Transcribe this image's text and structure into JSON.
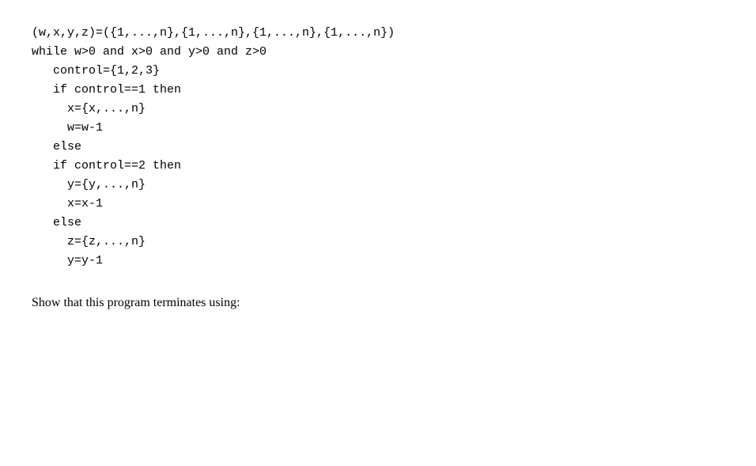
{
  "code": {
    "lines": [
      "(w,x,y,z)=({1,...,n},{1,...,n},{1,...,n},{1,...,n})",
      "while w>0 and x>0 and y>0 and z>0",
      "   control={1,2,3}",
      "   if control==1 then",
      "     x={x,...,n}",
      "     w=w-1",
      "   else",
      "   if control==2 then",
      "     y={y,...,n}",
      "     x=x-1",
      "   else",
      "     z={z,...,n}",
      "     y=y-1"
    ]
  },
  "prose": {
    "text": "Show that this program terminates using:"
  }
}
